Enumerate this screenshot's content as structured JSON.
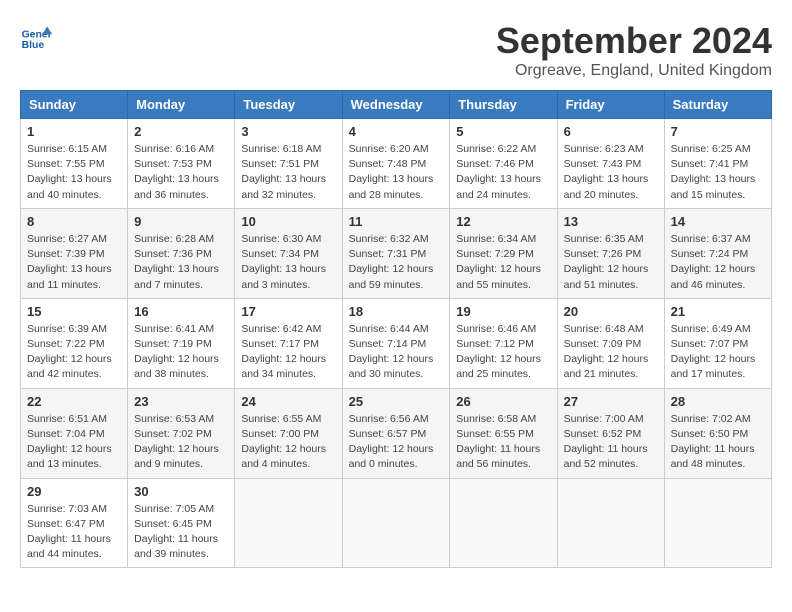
{
  "header": {
    "logo_line1": "General",
    "logo_line2": "Blue",
    "month_title": "September 2024",
    "location": "Orgreave, England, United Kingdom"
  },
  "weekdays": [
    "Sunday",
    "Monday",
    "Tuesday",
    "Wednesday",
    "Thursday",
    "Friday",
    "Saturday"
  ],
  "weeks": [
    [
      {
        "day": "1",
        "info": "Sunrise: 6:15 AM\nSunset: 7:55 PM\nDaylight: 13 hours\nand 40 minutes."
      },
      {
        "day": "2",
        "info": "Sunrise: 6:16 AM\nSunset: 7:53 PM\nDaylight: 13 hours\nand 36 minutes."
      },
      {
        "day": "3",
        "info": "Sunrise: 6:18 AM\nSunset: 7:51 PM\nDaylight: 13 hours\nand 32 minutes."
      },
      {
        "day": "4",
        "info": "Sunrise: 6:20 AM\nSunset: 7:48 PM\nDaylight: 13 hours\nand 28 minutes."
      },
      {
        "day": "5",
        "info": "Sunrise: 6:22 AM\nSunset: 7:46 PM\nDaylight: 13 hours\nand 24 minutes."
      },
      {
        "day": "6",
        "info": "Sunrise: 6:23 AM\nSunset: 7:43 PM\nDaylight: 13 hours\nand 20 minutes."
      },
      {
        "day": "7",
        "info": "Sunrise: 6:25 AM\nSunset: 7:41 PM\nDaylight: 13 hours\nand 15 minutes."
      }
    ],
    [
      {
        "day": "8",
        "info": "Sunrise: 6:27 AM\nSunset: 7:39 PM\nDaylight: 13 hours\nand 11 minutes."
      },
      {
        "day": "9",
        "info": "Sunrise: 6:28 AM\nSunset: 7:36 PM\nDaylight: 13 hours\nand 7 minutes."
      },
      {
        "day": "10",
        "info": "Sunrise: 6:30 AM\nSunset: 7:34 PM\nDaylight: 13 hours\nand 3 minutes."
      },
      {
        "day": "11",
        "info": "Sunrise: 6:32 AM\nSunset: 7:31 PM\nDaylight: 12 hours\nand 59 minutes."
      },
      {
        "day": "12",
        "info": "Sunrise: 6:34 AM\nSunset: 7:29 PM\nDaylight: 12 hours\nand 55 minutes."
      },
      {
        "day": "13",
        "info": "Sunrise: 6:35 AM\nSunset: 7:26 PM\nDaylight: 12 hours\nand 51 minutes."
      },
      {
        "day": "14",
        "info": "Sunrise: 6:37 AM\nSunset: 7:24 PM\nDaylight: 12 hours\nand 46 minutes."
      }
    ],
    [
      {
        "day": "15",
        "info": "Sunrise: 6:39 AM\nSunset: 7:22 PM\nDaylight: 12 hours\nand 42 minutes."
      },
      {
        "day": "16",
        "info": "Sunrise: 6:41 AM\nSunset: 7:19 PM\nDaylight: 12 hours\nand 38 minutes."
      },
      {
        "day": "17",
        "info": "Sunrise: 6:42 AM\nSunset: 7:17 PM\nDaylight: 12 hours\nand 34 minutes."
      },
      {
        "day": "18",
        "info": "Sunrise: 6:44 AM\nSunset: 7:14 PM\nDaylight: 12 hours\nand 30 minutes."
      },
      {
        "day": "19",
        "info": "Sunrise: 6:46 AM\nSunset: 7:12 PM\nDaylight: 12 hours\nand 25 minutes."
      },
      {
        "day": "20",
        "info": "Sunrise: 6:48 AM\nSunset: 7:09 PM\nDaylight: 12 hours\nand 21 minutes."
      },
      {
        "day": "21",
        "info": "Sunrise: 6:49 AM\nSunset: 7:07 PM\nDaylight: 12 hours\nand 17 minutes."
      }
    ],
    [
      {
        "day": "22",
        "info": "Sunrise: 6:51 AM\nSunset: 7:04 PM\nDaylight: 12 hours\nand 13 minutes."
      },
      {
        "day": "23",
        "info": "Sunrise: 6:53 AM\nSunset: 7:02 PM\nDaylight: 12 hours\nand 9 minutes."
      },
      {
        "day": "24",
        "info": "Sunrise: 6:55 AM\nSunset: 7:00 PM\nDaylight: 12 hours\nand 4 minutes."
      },
      {
        "day": "25",
        "info": "Sunrise: 6:56 AM\nSunset: 6:57 PM\nDaylight: 12 hours\nand 0 minutes."
      },
      {
        "day": "26",
        "info": "Sunrise: 6:58 AM\nSunset: 6:55 PM\nDaylight: 11 hours\nand 56 minutes."
      },
      {
        "day": "27",
        "info": "Sunrise: 7:00 AM\nSunset: 6:52 PM\nDaylight: 11 hours\nand 52 minutes."
      },
      {
        "day": "28",
        "info": "Sunrise: 7:02 AM\nSunset: 6:50 PM\nDaylight: 11 hours\nand 48 minutes."
      }
    ],
    [
      {
        "day": "29",
        "info": "Sunrise: 7:03 AM\nSunset: 6:47 PM\nDaylight: 11 hours\nand 44 minutes."
      },
      {
        "day": "30",
        "info": "Sunrise: 7:05 AM\nSunset: 6:45 PM\nDaylight: 11 hours\nand 39 minutes."
      },
      {
        "day": "",
        "info": ""
      },
      {
        "day": "",
        "info": ""
      },
      {
        "day": "",
        "info": ""
      },
      {
        "day": "",
        "info": ""
      },
      {
        "day": "",
        "info": ""
      }
    ]
  ]
}
